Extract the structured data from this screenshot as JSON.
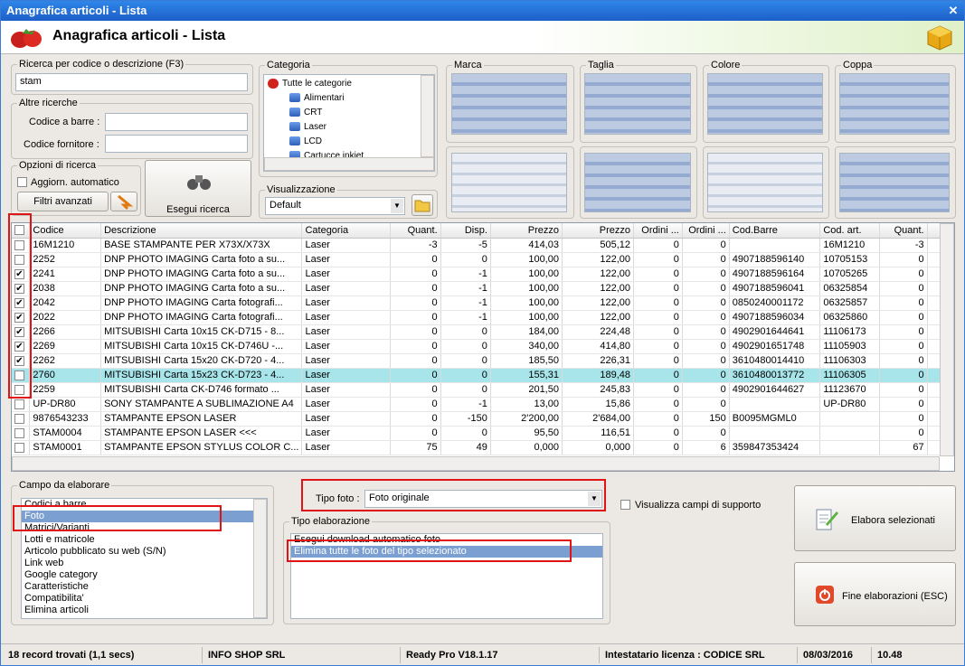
{
  "window": {
    "title": "Anagrafica articoli  - Lista",
    "header_title": "Anagrafica articoli  - Lista"
  },
  "search": {
    "label": "Ricerca per codice o descrizione (F3)",
    "value": "stam"
  },
  "other": {
    "label": "Altre ricerche",
    "barcode_label": "Codice a barre :",
    "supplier_label": "Codice fornitore :"
  },
  "options": {
    "label": "Opzioni di ricerca",
    "auto_update": "Aggiorn. automatico",
    "advanced_filters": "Filtri avanzati",
    "run_search": "Esegui ricerca"
  },
  "category": {
    "label": "Categoria",
    "items": [
      "Tutte le categorie",
      "Alimentari",
      "CRT",
      "Laser",
      "LCD",
      "Cartucce inkjet"
    ]
  },
  "view": {
    "label": "Visualizzazione",
    "value": "Default"
  },
  "filters": {
    "marca": "Marca",
    "taglia": "Taglia",
    "colore": "Colore",
    "coppa": "Coppa"
  },
  "grid": {
    "columns": [
      "Codice",
      "Descrizione",
      "Categoria",
      "Quant.",
      "Disp.",
      "Prezzo",
      "Prezzo",
      "Ordini ...",
      "Ordini ...",
      "Cod.Barre",
      "Cod. art.",
      "Quant."
    ],
    "rows": [
      {
        "checked": false,
        "cells": [
          "16M1210",
          "BASE STAMPANTE PER X73X/X73X",
          "Laser",
          "-3",
          "-5",
          "414,03",
          "505,12",
          "0",
          "0",
          "",
          "16M1210",
          "-3"
        ]
      },
      {
        "checked": false,
        "cells": [
          "2252",
          "DNP PHOTO IMAGING Carta foto a su...",
          "Laser",
          "0",
          "0",
          "100,00",
          "122,00",
          "0",
          "0",
          "4907188596140",
          "10705153",
          "0"
        ]
      },
      {
        "checked": true,
        "cells": [
          "2241",
          "DNP PHOTO IMAGING Carta foto a su...",
          "Laser",
          "0",
          "-1",
          "100,00",
          "122,00",
          "0",
          "0",
          "4907188596164",
          "10705265",
          "0"
        ]
      },
      {
        "checked": true,
        "cells": [
          "2038",
          "DNP PHOTO IMAGING Carta foto a su...",
          "Laser",
          "0",
          "-1",
          "100,00",
          "122,00",
          "0",
          "0",
          "4907188596041",
          "06325854",
          "0"
        ]
      },
      {
        "checked": true,
        "cells": [
          "2042",
          "DNP PHOTO IMAGING Carta fotografi...",
          "Laser",
          "0",
          "-1",
          "100,00",
          "122,00",
          "0",
          "0",
          "0850240001172",
          "06325857",
          "0"
        ]
      },
      {
        "checked": true,
        "cells": [
          "2022",
          "DNP PHOTO IMAGING Carta fotografi...",
          "Laser",
          "0",
          "-1",
          "100,00",
          "122,00",
          "0",
          "0",
          "4907188596034",
          "06325860",
          "0"
        ]
      },
      {
        "checked": true,
        "cells": [
          "2266",
          "MITSUBISHI Carta 10x15 CK-D715 - 8...",
          "Laser",
          "0",
          "0",
          "184,00",
          "224,48",
          "0",
          "0",
          "4902901644641",
          "11106173",
          "0"
        ]
      },
      {
        "checked": true,
        "cells": [
          "2269",
          "MITSUBISHI Carta 10x15 CK-D746U -...",
          "Laser",
          "0",
          "0",
          "340,00",
          "414,80",
          "0",
          "0",
          "4902901651748",
          "11105903",
          "0"
        ]
      },
      {
        "checked": true,
        "cells": [
          "2262",
          "MITSUBISHI Carta 15x20 CK-D720 - 4...",
          "Laser",
          "0",
          "0",
          "185,50",
          "226,31",
          "0",
          "0",
          "3610480014410",
          "11106303",
          "0"
        ]
      },
      {
        "checked": false,
        "cells": [
          "2760",
          "MITSUBISHI Carta 15x23 CK-D723 - 4...",
          "Laser",
          "0",
          "0",
          "155,31",
          "189,48",
          "0",
          "0",
          "3610480013772",
          "11106305",
          "0"
        ]
      },
      {
        "checked": false,
        "cells": [
          "2259",
          "MITSUBISHI Carta CK-D746 formato ...",
          "Laser",
          "0",
          "0",
          "201,50",
          "245,83",
          "0",
          "0",
          "4902901644627",
          "11123670",
          "0"
        ]
      },
      {
        "checked": false,
        "cells": [
          "UP-DR80",
          "SONY STAMPANTE A SUBLIMAZIONE A4",
          "Laser",
          "0",
          "-1",
          "13,00",
          "15,86",
          "0",
          "0",
          "",
          "UP-DR80",
          "0"
        ]
      },
      {
        "checked": false,
        "cells": [
          "9876543233",
          "STAMPANTE EPSON LASER",
          "Laser",
          "0",
          "-150",
          "2'200,00",
          "2'684,00",
          "0",
          "150",
          "B0095MGML0",
          "",
          "0"
        ]
      },
      {
        "checked": false,
        "cells": [
          "STAM0004",
          "STAMPANTE EPSON LASER <<<",
          "Laser",
          "0",
          "0",
          "95,50",
          "116,51",
          "0",
          "0",
          "",
          "",
          "0"
        ]
      },
      {
        "checked": false,
        "cells": [
          "STAM0001",
          "STAMPANTE EPSON STYLUS COLOR C...",
          "Laser",
          "75",
          "49",
          "0,000",
          "0,000",
          "0",
          "6",
          "359847353424",
          "",
          "67"
        ]
      }
    ]
  },
  "campo": {
    "label": "Campo da elaborare",
    "items": [
      "Codici a barre",
      "Foto",
      "Matrici/Varianti",
      "Lotti e matricole",
      "Articolo pubblicato su web (S/N)",
      "Link web",
      "Google category",
      "Caratteristiche",
      "Compatibilita'",
      "Elimina articoli"
    ],
    "selected_index": 1
  },
  "tipo_foto": {
    "label": "Tipo foto :",
    "value": "Foto originale"
  },
  "support_fields": "Visualizza campi di supporto",
  "tipo_elab": {
    "label": "Tipo elaborazione",
    "items": [
      "Esegui download automatico foto",
      "Elimina tutte le foto del tipo selezionato"
    ],
    "selected_index": 1
  },
  "actions": {
    "process": "Elabora selezionati",
    "end": "Fine elaborazioni (ESC)"
  },
  "status": {
    "records": "18 record trovati (1,1 secs)",
    "company": "INFO SHOP SRL",
    "version": "Ready Pro V18.1.17",
    "license": "Intestatario licenza : CODICE SRL",
    "date": "08/03/2016",
    "time": "10.48"
  }
}
